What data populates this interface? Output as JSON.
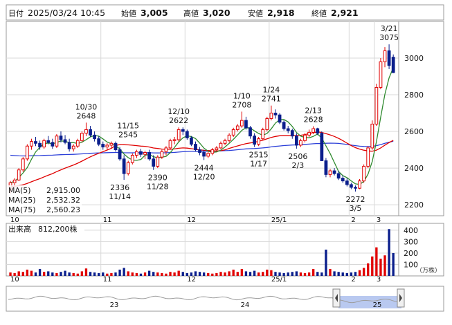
{
  "header": {
    "date_label": "日付",
    "datetime": "2025/03/24 10:45",
    "open_label": "始値",
    "open_value": "3,005",
    "high_label": "高値",
    "high_value": "3,020",
    "low_label": "安値",
    "low_value": "2,918",
    "close_label": "終値",
    "close_value": "2,921",
    "colors": {
      "high": "#e00000",
      "low": "#008000",
      "text": "#111111"
    }
  },
  "legend": [
    {
      "label": "MA(5)",
      "value": "2,915.00",
      "color": "#2f8a2f"
    },
    {
      "label": "MA(25)",
      "value": "2,532.32",
      "color": "#e00000"
    },
    {
      "label": "MA(75)",
      "value": "2,560.23",
      "color": "#2b3fd8"
    }
  ],
  "volume_header": {
    "label": "出来高",
    "value": "812,200株"
  },
  "volume_unit": "（万株）",
  "colors": {
    "up": "#e00000",
    "down": "#0a1e8c",
    "nav_fill": "#b9c9f0"
  },
  "chart_data": [
    {
      "type": "candlestick",
      "price_axis": {
        "ticks": [
          2200,
          2400,
          2600,
          2800,
          3000
        ],
        "range": [
          2140,
          3200
        ]
      },
      "x_axis_labels": [
        "10",
        "11",
        "12",
        "25/1",
        "2",
        "3"
      ],
      "annotations": [
        {
          "date": "10/30",
          "value": "2648"
        },
        {
          "date": "11/15",
          "value": "2545"
        },
        {
          "date": "11/14",
          "value": "2336"
        },
        {
          "date": "11/28",
          "value": "2390"
        },
        {
          "date": "12/10",
          "value": "2622"
        },
        {
          "date": "12/20",
          "value": "2444"
        },
        {
          "date": "1/10",
          "value": "2708"
        },
        {
          "date": "1/17",
          "value": "2515"
        },
        {
          "date": "1/24",
          "value": "2741"
        },
        {
          "date": "2/3",
          "value": "2506"
        },
        {
          "date": "2/13",
          "value": "2628"
        },
        {
          "date": "3/5",
          "value": "2272"
        },
        {
          "date": "3/21",
          "value": "3075"
        }
      ],
      "ohlc_points": [
        [
          2280,
          2330,
          2260,
          2320
        ],
        [
          2320,
          2345,
          2300,
          2335
        ],
        [
          2335,
          2400,
          2330,
          2390
        ],
        [
          2390,
          2460,
          2380,
          2450
        ],
        [
          2450,
          2530,
          2440,
          2520
        ],
        [
          2520,
          2560,
          2500,
          2545
        ],
        [
          2545,
          2570,
          2520,
          2535
        ],
        [
          2535,
          2550,
          2500,
          2515
        ],
        [
          2515,
          2560,
          2505,
          2550
        ],
        [
          2550,
          2575,
          2530,
          2540
        ],
        [
          2540,
          2560,
          2505,
          2520
        ],
        [
          2520,
          2585,
          2510,
          2575
        ],
        [
          2575,
          2600,
          2540,
          2555
        ],
        [
          2555,
          2580,
          2530,
          2540
        ],
        [
          2540,
          2560,
          2490,
          2505
        ],
        [
          2505,
          2530,
          2490,
          2520
        ],
        [
          2520,
          2560,
          2510,
          2550
        ],
        [
          2550,
          2600,
          2540,
          2590
        ],
        [
          2590,
          2648,
          2575,
          2610
        ],
        [
          2610,
          2630,
          2570,
          2580
        ],
        [
          2580,
          2600,
          2545,
          2560
        ],
        [
          2560,
          2575,
          2520,
          2530
        ],
        [
          2530,
          2545,
          2500,
          2515
        ],
        [
          2515,
          2535,
          2500,
          2525
        ],
        [
          2525,
          2545,
          2510,
          2535
        ],
        [
          2535,
          2545,
          2490,
          2500
        ],
        [
          2500,
          2515,
          2440,
          2450
        ],
        [
          2450,
          2470,
          2336,
          2370
        ],
        [
          2370,
          2440,
          2360,
          2430
        ],
        [
          2430,
          2480,
          2420,
          2470
        ],
        [
          2470,
          2500,
          2455,
          2490
        ],
        [
          2490,
          2505,
          2460,
          2475
        ],
        [
          2475,
          2495,
          2450,
          2485
        ],
        [
          2485,
          2500,
          2440,
          2450
        ],
        [
          2450,
          2470,
          2390,
          2410
        ],
        [
          2410,
          2470,
          2400,
          2460
        ],
        [
          2460,
          2500,
          2450,
          2490
        ],
        [
          2490,
          2520,
          2470,
          2510
        ],
        [
          2510,
          2560,
          2500,
          2550
        ],
        [
          2550,
          2570,
          2530,
          2555
        ],
        [
          2555,
          2622,
          2545,
          2610
        ],
        [
          2610,
          2622,
          2580,
          2600
        ],
        [
          2600,
          2610,
          2555,
          2565
        ],
        [
          2565,
          2575,
          2520,
          2530
        ],
        [
          2530,
          2545,
          2490,
          2500
        ],
        [
          2500,
          2515,
          2470,
          2485
        ],
        [
          2485,
          2500,
          2444,
          2465
        ],
        [
          2465,
          2490,
          2455,
          2480
        ],
        [
          2480,
          2510,
          2470,
          2500
        ],
        [
          2500,
          2520,
          2490,
          2510
        ],
        [
          2510,
          2545,
          2505,
          2535
        ],
        [
          2535,
          2560,
          2525,
          2550
        ],
        [
          2550,
          2590,
          2540,
          2580
        ],
        [
          2580,
          2620,
          2570,
          2610
        ],
        [
          2610,
          2640,
          2600,
          2630
        ],
        [
          2630,
          2708,
          2620,
          2660
        ],
        [
          2660,
          2680,
          2610,
          2620
        ],
        [
          2620,
          2630,
          2560,
          2575
        ],
        [
          2575,
          2590,
          2515,
          2530
        ],
        [
          2530,
          2570,
          2520,
          2560
        ],
        [
          2560,
          2620,
          2550,
          2610
        ],
        [
          2610,
          2680,
          2600,
          2670
        ],
        [
          2670,
          2741,
          2660,
          2700
        ],
        [
          2700,
          2720,
          2670,
          2690
        ],
        [
          2690,
          2700,
          2640,
          2650
        ],
        [
          2650,
          2660,
          2605,
          2615
        ],
        [
          2615,
          2630,
          2590,
          2605
        ],
        [
          2605,
          2615,
          2560,
          2575
        ],
        [
          2575,
          2590,
          2506,
          2525
        ],
        [
          2525,
          2560,
          2515,
          2550
        ],
        [
          2550,
          2590,
          2540,
          2580
        ],
        [
          2580,
          2610,
          2570,
          2595
        ],
        [
          2595,
          2628,
          2585,
          2615
        ],
        [
          2615,
          2620,
          2580,
          2590
        ],
        [
          2590,
          2600,
          2520,
          2440
        ],
        [
          2440,
          2455,
          2350,
          2365
        ],
        [
          2365,
          2395,
          2350,
          2385
        ],
        [
          2385,
          2400,
          2360,
          2370
        ],
        [
          2370,
          2385,
          2335,
          2345
        ],
        [
          2345,
          2360,
          2320,
          2330
        ],
        [
          2330,
          2345,
          2300,
          2310
        ],
        [
          2310,
          2320,
          2285,
          2295
        ],
        [
          2295,
          2305,
          2272,
          2290
        ],
        [
          2290,
          2340,
          2285,
          2330
        ],
        [
          2330,
          2420,
          2320,
          2410
        ],
        [
          2410,
          2520,
          2400,
          2510
        ],
        [
          2510,
          2660,
          2500,
          2640
        ],
        [
          2640,
          2860,
          2630,
          2840
        ],
        [
          2840,
          3000,
          2830,
          2980
        ],
        [
          2980,
          3060,
          2950,
          3040
        ],
        [
          3040,
          3075,
          2940,
          2960
        ],
        [
          3005,
          3020,
          2918,
          2921
        ]
      ],
      "volume_axis": {
        "ticks": [
          100,
          200,
          300,
          400
        ],
        "unit": "万株"
      },
      "volume_values": [
        30,
        25,
        40,
        35,
        55,
        45,
        30,
        60,
        35,
        40,
        30,
        25,
        35,
        45,
        30,
        25,
        20,
        40,
        65,
        35,
        30,
        25,
        30,
        20,
        25,
        30,
        55,
        70,
        40,
        30,
        25,
        20,
        30,
        45,
        35,
        30,
        25,
        20,
        35,
        30,
        45,
        35,
        25,
        30,
        40,
        35,
        30,
        25,
        20,
        25,
        35,
        30,
        40,
        55,
        35,
        60,
        40,
        35,
        45,
        30,
        35,
        55,
        50,
        35,
        30,
        25,
        30,
        35,
        40,
        30,
        25,
        30,
        60,
        35,
        30,
        230,
        60,
        40,
        35,
        30,
        25,
        30,
        35,
        50,
        70,
        110,
        170,
        250,
        150,
        180,
        410,
        200,
        310,
        130
      ],
      "ma_lines": [
        "MA(5)",
        "MA(25)",
        "MA(75)"
      ],
      "navigator": {
        "labels": [
          "23",
          "24",
          "25"
        ]
      }
    }
  ]
}
